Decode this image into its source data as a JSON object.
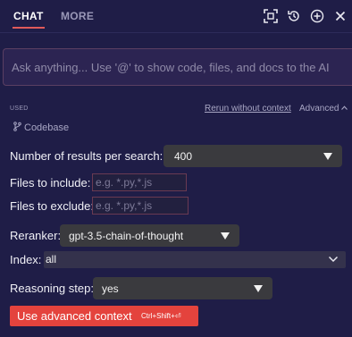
{
  "tabs": {
    "chat": "CHAT",
    "more": "MORE"
  },
  "toolbar": {
    "icons": [
      "expand-icon",
      "history-icon",
      "new-chat-icon",
      "close-icon"
    ]
  },
  "prompt": {
    "placeholder": "Ask anything... Use '@' to show code, files, and docs to the AI"
  },
  "context": {
    "used_label": "USED",
    "rerun_label": "Rerun without context",
    "advanced_label": "Advanced",
    "codebase_label": "Codebase"
  },
  "settings": {
    "results_label": "Number of results per search:",
    "results_value": "400",
    "include_label": "Files to include:",
    "include_placeholder": "e.g. *.py,*.js",
    "exclude_label": "Files to exclude:",
    "exclude_placeholder": "e.g. *.py,*.js",
    "reranker_label": "Reranker:",
    "reranker_value": "gpt-3.5-chain-of-thought",
    "index_label": "Index:",
    "index_value": "all",
    "reasoning_label": "Reasoning step:",
    "reasoning_value": "yes"
  },
  "action": {
    "button_label": "Use advanced context",
    "shortcut": "Ctrl+Shift+⏎"
  },
  "colors": {
    "background": "#1f1d47",
    "accent": "#e4433d",
    "tab_underline": "#e05a5a"
  }
}
